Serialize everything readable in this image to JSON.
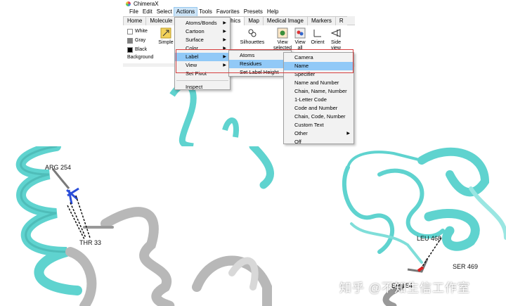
{
  "window": {
    "title": "ChimeraX"
  },
  "menubar": [
    "File",
    "Edit",
    "Select",
    "Actions",
    "Tools",
    "Favorites",
    "Presets",
    "Help"
  ],
  "tabs": [
    "Home",
    "Molecule",
    "Graphics",
    "Map",
    "Medical Image",
    "Markers",
    "R"
  ],
  "background": {
    "label": "Background",
    "options": [
      {
        "label": "White",
        "color": "#ffffff"
      },
      {
        "label": "Gray",
        "color": "#808080"
      },
      {
        "label": "Black",
        "color": "#000000"
      }
    ]
  },
  "tools": {
    "simple": "Simple",
    "partial_ow": "ow",
    "silhouettes": "Silhouettes",
    "view_selected": [
      "View",
      "selected"
    ],
    "view_all": [
      "View",
      "all"
    ],
    "orient": "Orient",
    "side_view": [
      "Side",
      "view"
    ]
  },
  "actions_menu": {
    "items": [
      "Atoms/Bonds",
      "Cartoon",
      "Surface",
      "Color",
      "Label",
      "View",
      "Set Pivot",
      "Inspect"
    ]
  },
  "label_submenu": {
    "items": [
      "Atoms",
      "Residues",
      "Set Label Height"
    ]
  },
  "residues_submenu": {
    "items": [
      "Camera",
      "Name",
      "Specifier",
      "Name and Number",
      "Chain, Name, Number",
      "1-Letter Code",
      "Code and Number",
      "Chain, Code, Number",
      "Custom Text",
      "Other",
      "Off"
    ]
  },
  "residue_labels": {
    "left": [
      "ARG 254",
      "THR 33"
    ],
    "right": [
      "LEU 468",
      "SER 469",
      "ER 154"
    ]
  },
  "watermark": "知乎 @不知生信工作室",
  "colors": {
    "cartoon_cyan": "#5fd3cf",
    "cartoon_gray": "#b8b8b8",
    "highlight": "#91c9f7",
    "annotation_red": "#d63f3f"
  }
}
